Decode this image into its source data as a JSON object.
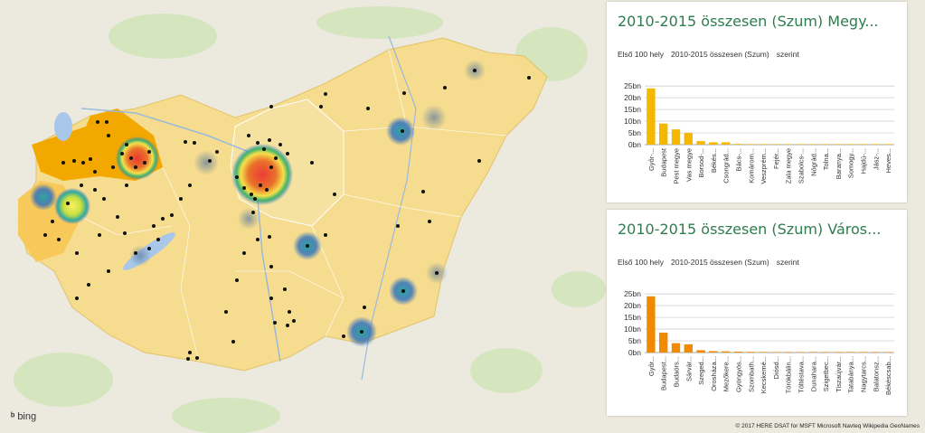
{
  "map": {
    "attribution": "© 2017 HERE  DSAT for MSFT  Microsoft  Navteq  Wikipedia  GeoNames",
    "logo": "bing",
    "region_color": "#f2c94c",
    "point_color": "#111111"
  },
  "panels": [
    {
      "title": "2010-2015 összesen (Szum) Megy...",
      "subtitle_left": "Első 100 hely",
      "subtitle_mid": "2010-2015 összesen (Szum)",
      "subtitle_right": "szerint"
    },
    {
      "title": "2010-2015 összesen (Szum) Város...",
      "subtitle_left": "Első 100 hely",
      "subtitle_mid": "2010-2015 összesen (Szum)",
      "subtitle_right": "szerint"
    }
  ],
  "chart_data": [
    {
      "type": "bar",
      "color": "#f5b800",
      "categories": [
        "Győr-...",
        "Budapest",
        "Pest megye",
        "Vas megye",
        "Borsod-...",
        "Békés...",
        "Csongrád...",
        "Bács-...",
        "Komárom...",
        "Veszprém...",
        "Fejér...",
        "Zala megye",
        "Szabolcs-...",
        "Nógrád...",
        "Tolna...",
        "Baranya...",
        "Somogy...",
        "Hajdú-...",
        "Jász-...",
        "Heves..."
      ],
      "values": [
        24,
        9,
        6.5,
        5,
        1.5,
        1,
        1,
        0.3,
        0.2,
        0.2,
        0.1,
        0.1,
        0.05,
        0.05,
        0.05,
        0.05,
        0.03,
        0.03,
        0.03,
        0.02
      ],
      "yticks": [
        "0bn",
        "5bn",
        "10bn",
        "15bn",
        "20bn",
        "25bn"
      ],
      "ylim": [
        0,
        27
      ]
    },
    {
      "type": "bar",
      "color": "#f08a00",
      "categories": [
        "Győr...",
        "Budapest...",
        "Budaörs...",
        "Sárvár...",
        "Szeged...",
        "Orosháza...",
        "Mezőkere...",
        "Gyöngyös...",
        "Szombath...",
        "Kecskemé...",
        "Diósd...",
        "Törökbálin...",
        "Töltéstava...",
        "Dunahara...",
        "Szigetbec...",
        "Tiszaújvár...",
        "Tatabánya...",
        "Nagytarcs...",
        "Balatonsz...",
        "Békéscsab..."
      ],
      "values": [
        24,
        8.5,
        4,
        3.5,
        1,
        0.6,
        0.5,
        0.4,
        0.3,
        0.2,
        0.15,
        0.1,
        0.1,
        0.08,
        0.06,
        0.05,
        0.05,
        0.04,
        0.03,
        0.02
      ],
      "yticks": [
        "0bn",
        "5bn",
        "10bn",
        "15bn",
        "20bn",
        "25bn"
      ],
      "ylim": [
        0,
        27
      ]
    }
  ]
}
